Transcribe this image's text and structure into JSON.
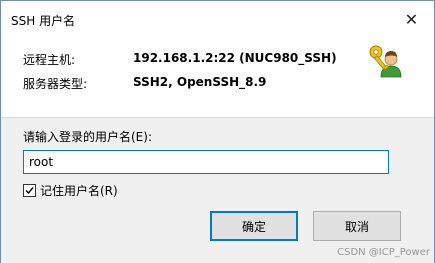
{
  "window": {
    "title": "SSH 用户名",
    "close_glyph": "✕"
  },
  "info": {
    "host_label": "远程主机:",
    "host_value": "192.168.1.2:22 (NUC980_SSH)",
    "server_type_label": "服务器类型:",
    "server_type_value": "SSH2, OpenSSH_8.9"
  },
  "form": {
    "prompt_label": "请输入登录的用户名(E):",
    "username_value": "root",
    "remember_label": "记住用户名(R)",
    "remember_checked": true
  },
  "buttons": {
    "ok_label": "确定",
    "cancel_label": "取消"
  },
  "watermark": "CSDN @ICP_Power",
  "colors": {
    "focus_border": "#0078d7",
    "form_background": "#f0f0f0",
    "button_background": "#e1e1e1"
  },
  "icons": {
    "key": "key-user-icon",
    "close": "close-icon",
    "check": "checkmark-icon"
  }
}
